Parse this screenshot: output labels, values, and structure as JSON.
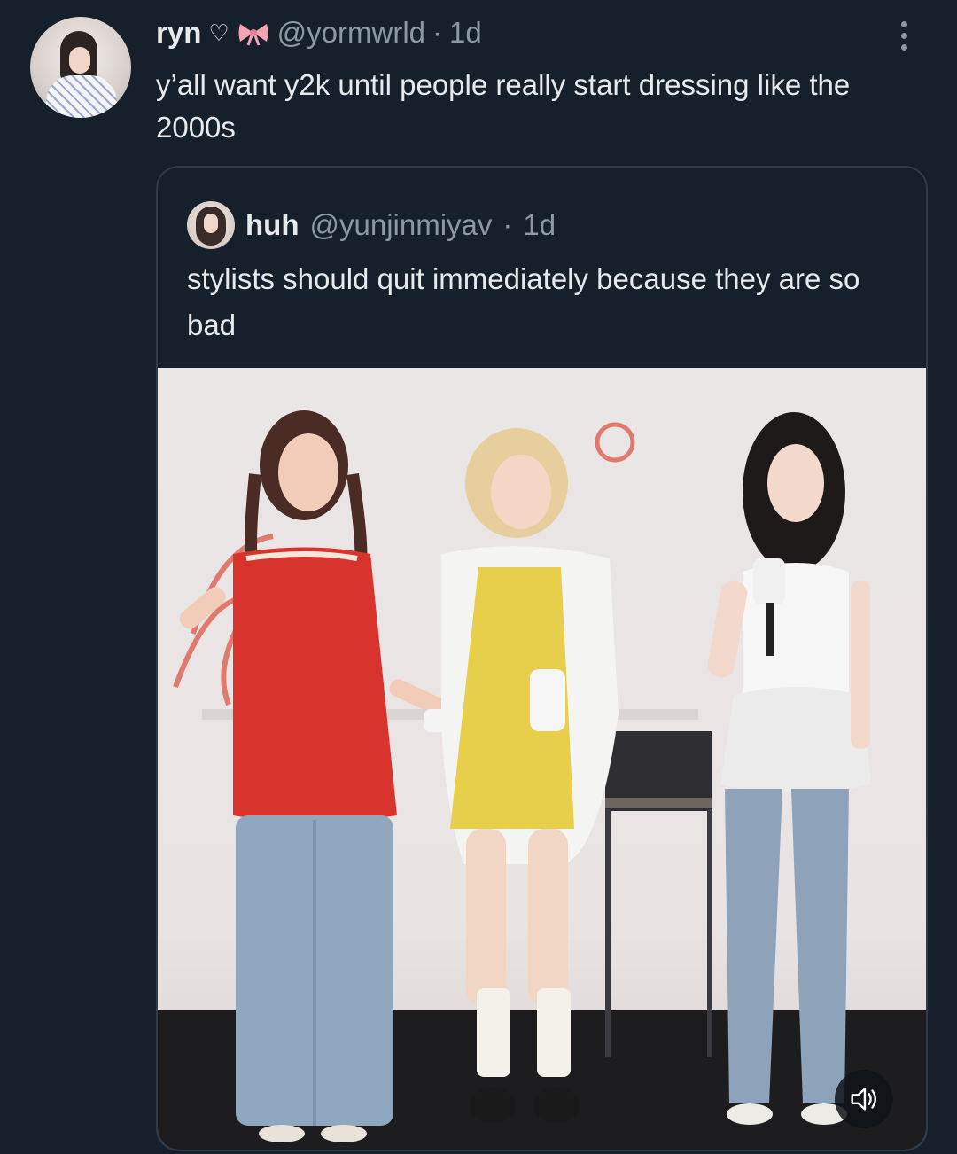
{
  "tweet": {
    "author_name": "ryn",
    "handle": "@yormwrld",
    "separator": "·",
    "time": "1d",
    "text": "y’all want y2k until people really start dressing like the 2000s"
  },
  "quoted_tweet": {
    "author_name": "huh",
    "handle": "@yunjinmiyav",
    "separator": "·",
    "time": "1d",
    "text": "stylists should quit immediately because they are so bad"
  },
  "icons": {
    "author_badges": [
      "heart-outline-icon",
      "bow-icon"
    ],
    "more": "more-vertical-icon",
    "media_control": "volume-icon"
  },
  "colors": {
    "background": "#16202b",
    "primary_text": "#e7e9ea",
    "secondary_text": "#8b98a5",
    "border": "#2f3b47"
  }
}
